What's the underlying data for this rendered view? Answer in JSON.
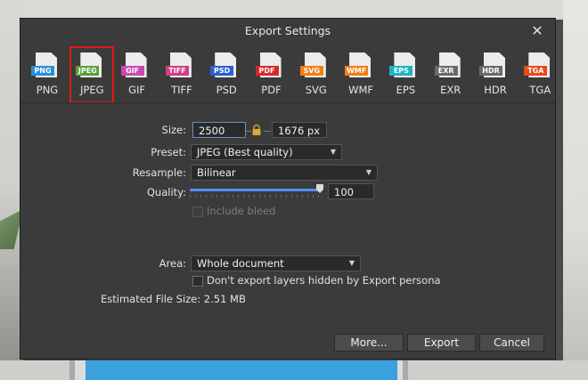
{
  "dialog": {
    "title": "Export Settings",
    "close": "✕"
  },
  "formats": [
    {
      "tag": "PNG",
      "label": "PNG",
      "color": "#2b8fd8",
      "selected": false
    },
    {
      "tag": "JPEG",
      "label": "JPEG",
      "color": "#58a13a",
      "selected": true
    },
    {
      "tag": "GIF",
      "label": "GIF",
      "color": "#c64ab2",
      "selected": false
    },
    {
      "tag": "TIFF",
      "label": "TIFF",
      "color": "#d23b83",
      "selected": false
    },
    {
      "tag": "PSD",
      "label": "PSD",
      "color": "#2a5fcf",
      "selected": false
    },
    {
      "tag": "PDF",
      "label": "PDF",
      "color": "#d52a2a",
      "selected": false
    },
    {
      "tag": "SVG",
      "label": "SVG",
      "color": "#f07f15",
      "selected": false
    },
    {
      "tag": "WMF",
      "label": "WMF",
      "color": "#f07f15",
      "selected": false
    },
    {
      "tag": "EPS",
      "label": "EPS",
      "color": "#1fb3c4",
      "selected": false
    },
    {
      "tag": "EXR",
      "label": "EXR",
      "color": "#6a6a6a",
      "selected": false
    },
    {
      "tag": "HDR",
      "label": "HDR",
      "color": "#6a6a6a",
      "selected": false
    },
    {
      "tag": "TGA",
      "label": "TGA",
      "color": "#e84a1a",
      "selected": false
    }
  ],
  "size": {
    "label": "Size:",
    "width": "2500 px",
    "height": "1676 px"
  },
  "preset": {
    "label": "Preset:",
    "value": "JPEG (Best quality)"
  },
  "resample": {
    "label": "Resample:",
    "value": "Bilinear"
  },
  "quality": {
    "label": "Quality:",
    "value": "100",
    "fraction": 1.0
  },
  "include_bleed": {
    "label": "Include bleed",
    "checked": false,
    "disabled": true
  },
  "area": {
    "label": "Area:",
    "value": "Whole document"
  },
  "dont_export_hidden": {
    "label": "Don't export layers hidden by Export persona",
    "checked": false
  },
  "estimated": {
    "label": "Estimated File Size:",
    "value": "2.51 MB"
  },
  "buttons": {
    "more": "More...",
    "export": "Export",
    "cancel": "Cancel"
  }
}
